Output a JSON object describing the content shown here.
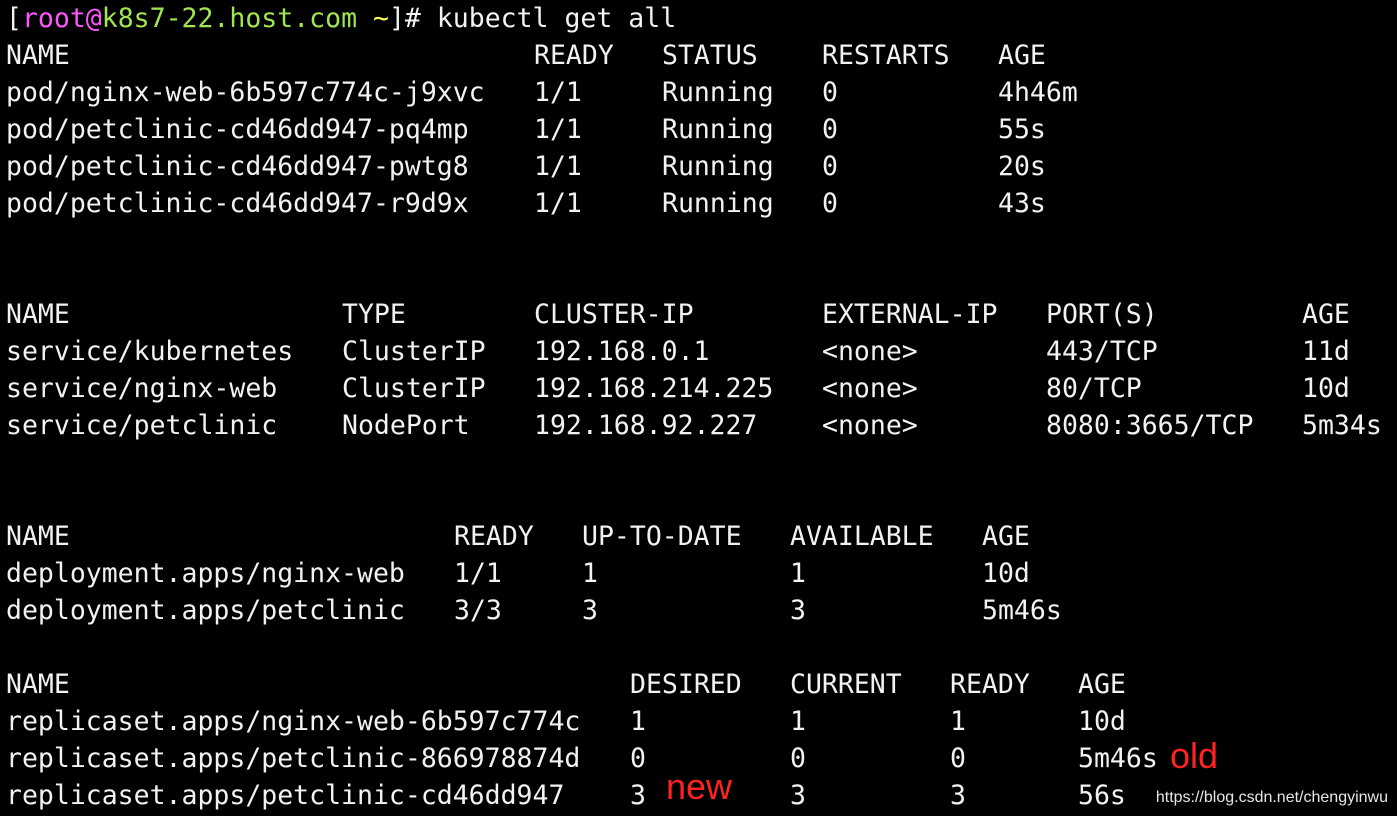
{
  "colors": {
    "background": "#000000",
    "text": "#f2f2f2",
    "prompt_user": "#ff55ff",
    "prompt_host": "#a0e650",
    "prompt_dir": "#ffff55",
    "annotation": "#ff2222",
    "watermark": "#e6e6e6"
  },
  "prompt": {
    "open_bracket": "[",
    "user": "root@",
    "host": "k8s7-22.host.com",
    "dir": "~",
    "symbol": "]#",
    "command": "kubectl get all"
  },
  "pods": {
    "headers": [
      "NAME",
      "READY",
      "STATUS",
      "RESTARTS",
      "AGE"
    ],
    "rows": [
      [
        "pod/nginx-web-6b597c774c-j9xvc",
        "1/1",
        "Running",
        "0",
        "4h46m"
      ],
      [
        "pod/petclinic-cd46dd947-pq4mp",
        "1/1",
        "Running",
        "0",
        "55s"
      ],
      [
        "pod/petclinic-cd46dd947-pwtg8",
        "1/1",
        "Running",
        "0",
        "20s"
      ],
      [
        "pod/petclinic-cd46dd947-r9d9x",
        "1/1",
        "Running",
        "0",
        "43s"
      ]
    ]
  },
  "services": {
    "headers": [
      "NAME",
      "TYPE",
      "CLUSTER-IP",
      "EXTERNAL-IP",
      "PORT(S)",
      "AGE"
    ],
    "rows": [
      [
        "service/kubernetes",
        "ClusterIP",
        "192.168.0.1",
        "<none>",
        "443/TCP",
        "11d"
      ],
      [
        "service/nginx-web",
        "ClusterIP",
        "192.168.214.225",
        "<none>",
        "80/TCP",
        "10d"
      ],
      [
        "service/petclinic",
        "NodePort",
        "192.168.92.227",
        "<none>",
        "8080:3665/TCP",
        "5m34s"
      ]
    ]
  },
  "deployments": {
    "headers": [
      "NAME",
      "READY",
      "UP-TO-DATE",
      "AVAILABLE",
      "AGE"
    ],
    "rows": [
      [
        "deployment.apps/nginx-web",
        "1/1",
        "1",
        "1",
        "10d"
      ],
      [
        "deployment.apps/petclinic",
        "3/3",
        "3",
        "3",
        "5m46s"
      ]
    ]
  },
  "replicasets": {
    "headers": [
      "NAME",
      "DESIRED",
      "CURRENT",
      "READY",
      "AGE"
    ],
    "rows": [
      [
        "replicaset.apps/nginx-web-6b597c774c",
        "1",
        "1",
        "1",
        "10d"
      ],
      [
        "replicaset.apps/petclinic-866978874d",
        "0",
        "0",
        "0",
        "5m46s"
      ],
      [
        "replicaset.apps/petclinic-cd46dd947",
        "3",
        "3",
        "3",
        "56s"
      ]
    ]
  },
  "annotations": {
    "old": "old",
    "new": "new"
  },
  "watermark": "https://blog.csdn.net/chengyinwu"
}
